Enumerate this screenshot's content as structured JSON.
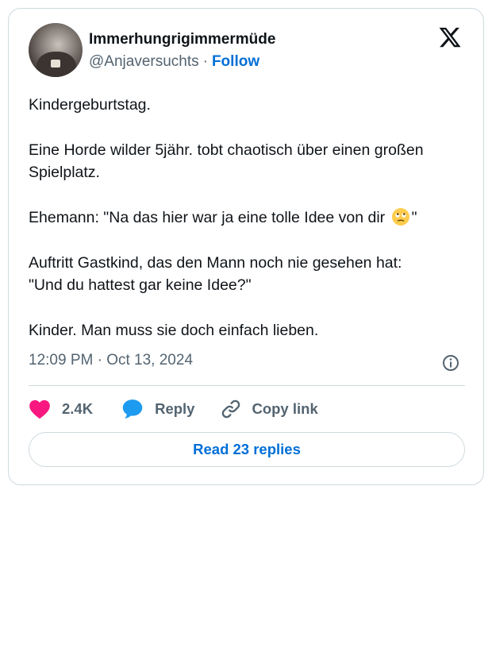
{
  "author": {
    "name": "Immerhungrigimmermüde",
    "handle": "@Anjaversuchts",
    "separator": "·",
    "follow_label": "Follow"
  },
  "tweet": {
    "paragraphs": [
      "Kindergeburtstag.",
      "Eine Horde wilder 5jähr. tobt chaotisch über einen großen Spielplatz.",
      "Ehemann: \"Na das hier war ja eine tolle Idee von dir",
      "\"",
      "Auftritt Gastkind, das den Mann noch nie gesehen hat:",
      "\"Und du hattest gar keine Idee?\"",
      "Kinder. Man muss sie doch einfach lieben."
    ],
    "emoji": "face-with-rolling-eyes-emoji",
    "timestamp": "12:09 PM · Oct 13, 2024"
  },
  "actions": {
    "like_count": "2.4K",
    "reply_label": "Reply",
    "copy_label": "Copy link"
  },
  "read_replies_label": "Read 23 replies",
  "colors": {
    "link": "#006fd6",
    "muted": "#536471",
    "text": "#0f1419",
    "heart": "#f91880",
    "reply_bubble": "#1d9bf0",
    "border": "#cfd9de"
  },
  "icons": {
    "logo": "x-logo-icon",
    "info": "info-icon",
    "like": "heart-icon",
    "reply": "speech-bubble-icon",
    "copy": "link-icon"
  }
}
